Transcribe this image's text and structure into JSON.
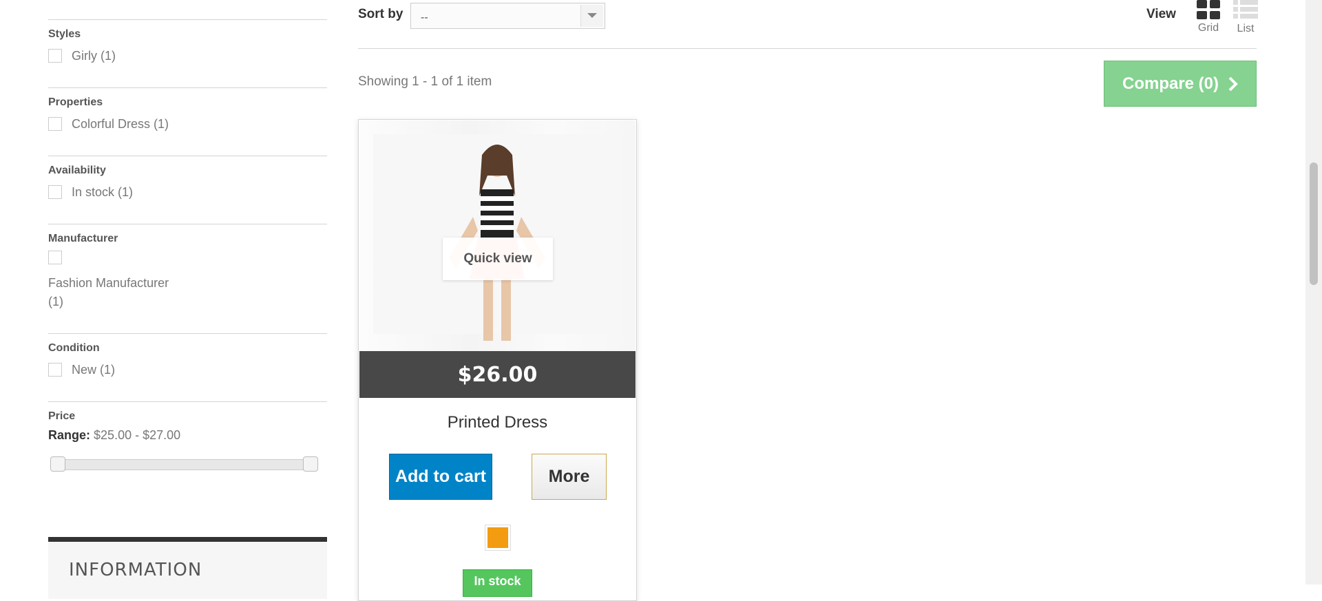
{
  "sidebar": {
    "filters": [
      {
        "title": "Styles",
        "items": [
          "Girly (1)"
        ]
      },
      {
        "title": "Properties",
        "items": [
          "Colorful Dress (1)"
        ]
      },
      {
        "title": "Availability",
        "items": [
          "In stock (1)"
        ]
      },
      {
        "title": "Manufacturer",
        "items": [
          "Fashion Manufacturer (1)"
        ]
      },
      {
        "title": "Condition",
        "items": [
          "New (1)"
        ]
      }
    ],
    "price": {
      "title": "Price",
      "range_label": "Range:",
      "range_value": "$25.00 - $27.00",
      "slider_min_fraction": 0,
      "slider_max_fraction": 1
    },
    "information_title": "INFORMATION"
  },
  "toolbar": {
    "sort_label": "Sort by",
    "sort_value": "--",
    "view_label": "View",
    "view_grid": "Grid",
    "view_list": "List",
    "active_view": "Grid"
  },
  "results": {
    "count_text": "Showing 1 - 1 of 1 item",
    "compare_label": "Compare (0)"
  },
  "product": {
    "quick_view": "Quick view",
    "price": "$26.00",
    "name": "Printed Dress",
    "add_to_cart": "Add to cart",
    "more": "More",
    "color": "#f39c11",
    "stock": "In stock"
  },
  "colors": {
    "compare_green": "#86d291",
    "add_blue": "#0084c7",
    "price_bar": "#484848",
    "stock_green": "#55c65e"
  }
}
